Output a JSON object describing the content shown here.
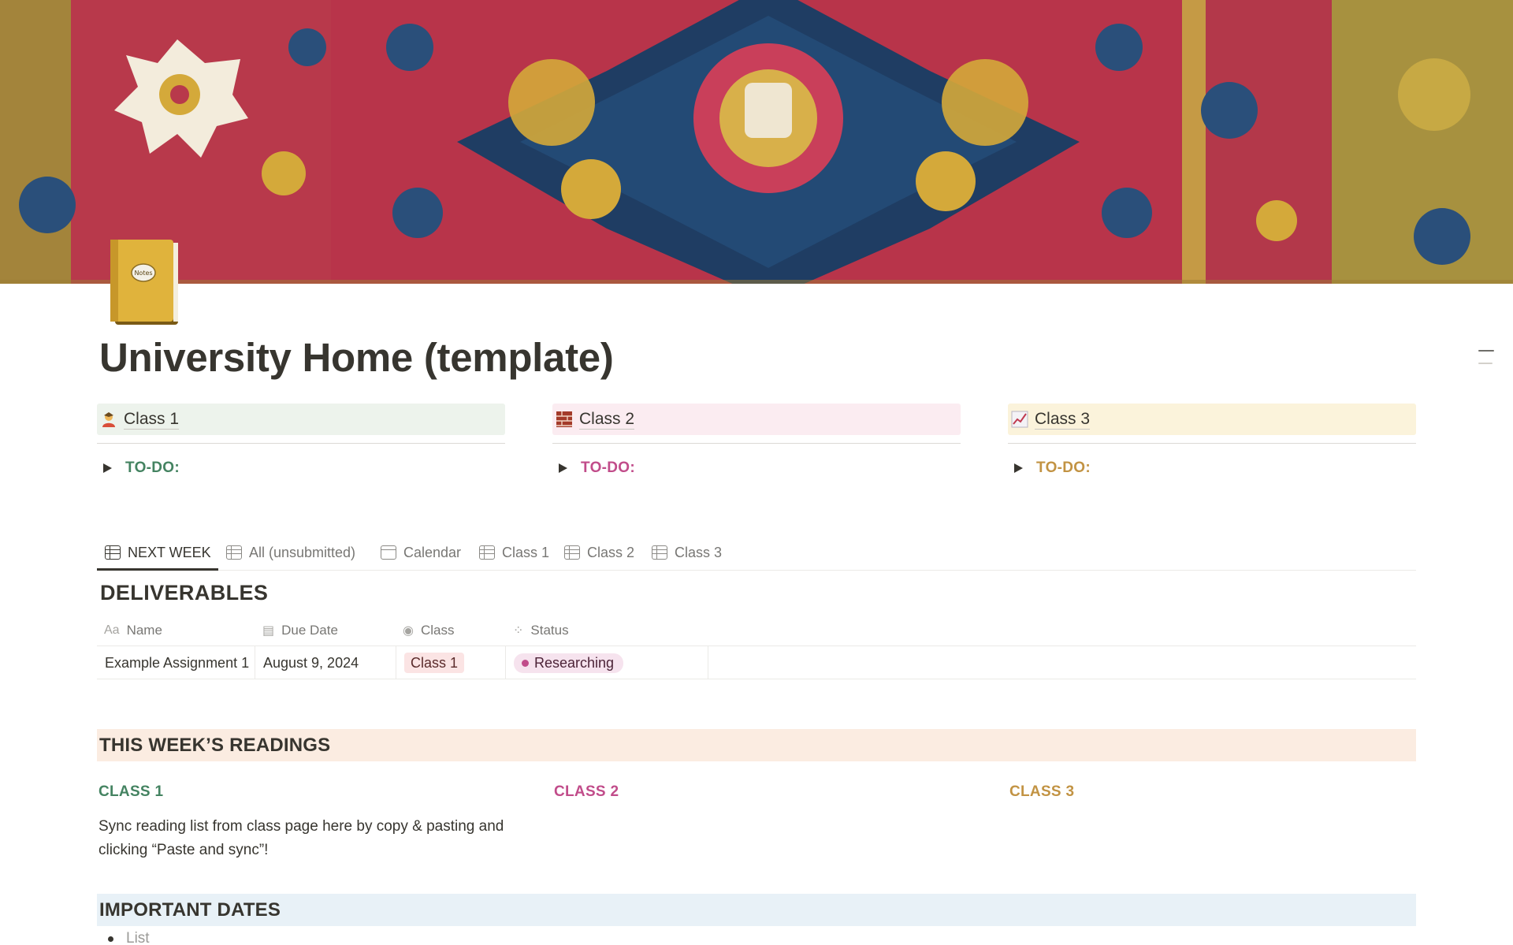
{
  "page": {
    "title": "University Home (template)",
    "icon": "notebook-icon",
    "icon_label": "Notes",
    "cover": "persian-rug-cover"
  },
  "classes": [
    {
      "name": "Class 1",
      "icon": "student-icon",
      "todo_label": "TO-DO:",
      "color": "#448361",
      "bg": "#edf3ec"
    },
    {
      "name": "Class 2",
      "icon": "bricks-icon",
      "todo_label": "TO-DO:",
      "color": "#c14c8a",
      "bg": "#fbecf1"
    },
    {
      "name": "Class 3",
      "icon": "chart-icon",
      "todo_label": "TO-DO:",
      "color": "#c29343",
      "bg": "#fbf3db"
    }
  ],
  "views": {
    "tabs": [
      {
        "label": "NEXT WEEK",
        "icon": "table-icon",
        "active": true
      },
      {
        "label": "All (unsubmitted)",
        "icon": "table-icon",
        "active": false
      },
      {
        "label": "Calendar",
        "icon": "calendar-icon",
        "active": false
      },
      {
        "label": "Class 1",
        "icon": "table-icon",
        "active": false
      },
      {
        "label": "Class 2",
        "icon": "table-icon",
        "active": false
      },
      {
        "label": "Class 3",
        "icon": "table-icon",
        "active": false
      }
    ]
  },
  "deliverables": {
    "title": "DELIVERABLES",
    "columns": [
      {
        "label": "Name",
        "icon": "text-icon",
        "icon_text": "Aa"
      },
      {
        "label": "Due Date",
        "icon": "calendar-icon"
      },
      {
        "label": "Class",
        "icon": "select-icon"
      },
      {
        "label": "Status",
        "icon": "status-icon"
      }
    ],
    "rows": [
      {
        "name": "Example Assignment 1",
        "due_date": "August 9, 2024",
        "class": "Class 1",
        "status": "Researching"
      }
    ]
  },
  "readings": {
    "title": "THIS WEEK’S READINGS",
    "columns": [
      {
        "label": "CLASS 1",
        "text": "Sync reading list from class page here by copy & pasting and clicking “Paste and sync”!"
      },
      {
        "label": "CLASS 2",
        "text": ""
      },
      {
        "label": "CLASS 3",
        "text": ""
      }
    ]
  },
  "important_dates": {
    "title": "IMPORTANT DATES",
    "items": [
      {
        "placeholder": "List"
      }
    ]
  },
  "colors": {
    "text": "#37352f",
    "muted": "#787774",
    "class1": "#448361",
    "class2": "#c14c8a",
    "class3": "#c29343",
    "readings_band": "#fbece1",
    "dates_band": "#e8f1f7"
  }
}
